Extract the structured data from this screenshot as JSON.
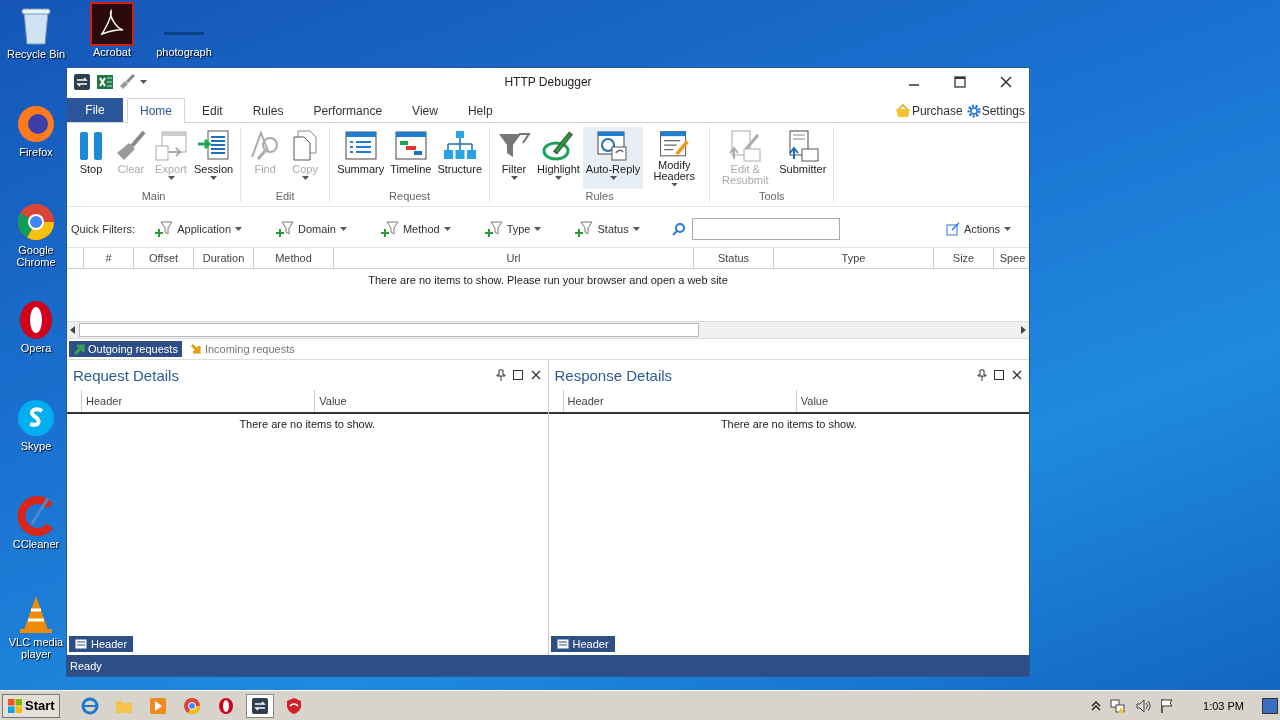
{
  "desktop": {
    "icons": [
      {
        "label": "Recycle Bin",
        "kind": "recycle"
      },
      {
        "label": "Firefox",
        "kind": "firefox"
      },
      {
        "label": "Google Chrome",
        "kind": "chrome"
      },
      {
        "label": "Opera",
        "kind": "opera"
      },
      {
        "label": "Skype",
        "kind": "skype"
      },
      {
        "label": "CCleaner",
        "kind": "ccleaner"
      },
      {
        "label": "VLC media player",
        "kind": "vlc"
      }
    ],
    "top_icons": [
      {
        "label": "Acrobat",
        "kind": "acrobat"
      },
      {
        "label": "photograph",
        "kind": "blank"
      }
    ]
  },
  "window": {
    "title": "HTTP Debugger",
    "file_tab": "File",
    "tabs": [
      {
        "label": "Home",
        "selected": true
      },
      {
        "label": "Edit",
        "selected": false
      },
      {
        "label": "Rules",
        "selected": false
      },
      {
        "label": "Performance",
        "selected": false
      },
      {
        "label": "View",
        "selected": false
      },
      {
        "label": "Help",
        "selected": false
      }
    ],
    "purchase": "Purchase",
    "settings": "Settings",
    "ribbon": [
      {
        "name": "Main",
        "buttons": [
          {
            "label": "Stop",
            "kind": "stop",
            "disabled": false,
            "dropdown": false
          },
          {
            "label": "Clear",
            "kind": "clear",
            "disabled": true,
            "dropdown": false
          },
          {
            "label": "Export",
            "kind": "export",
            "disabled": true,
            "dropdown": true
          },
          {
            "label": "Session",
            "kind": "session",
            "disabled": false,
            "dropdown": true
          }
        ]
      },
      {
        "name": "Edit",
        "buttons": [
          {
            "label": "Find",
            "kind": "find",
            "disabled": true,
            "dropdown": false
          },
          {
            "label": "Copy",
            "kind": "copy",
            "disabled": true,
            "dropdown": true
          }
        ]
      },
      {
        "name": "Request",
        "buttons": [
          {
            "label": "Summary",
            "kind": "summary",
            "disabled": false,
            "dropdown": false
          },
          {
            "label": "Timeline",
            "kind": "timeline",
            "disabled": false,
            "dropdown": false
          },
          {
            "label": "Structure",
            "kind": "structure",
            "disabled": false,
            "dropdown": false
          }
        ]
      },
      {
        "name": "Rules",
        "buttons": [
          {
            "label": "Filter",
            "kind": "filter",
            "disabled": false,
            "dropdown": true
          },
          {
            "label": "Highlight",
            "kind": "highlight",
            "disabled": false,
            "dropdown": true
          },
          {
            "label": "Auto-Reply",
            "kind": "autoreply",
            "disabled": false,
            "dropdown": true,
            "hovered": true
          },
          {
            "label": "Modify Headers",
            "kind": "modify",
            "disabled": false,
            "dropdown": true
          }
        ]
      },
      {
        "name": "Tools",
        "buttons": [
          {
            "label": "Edit & Resubmit",
            "kind": "resubmit",
            "disabled": true,
            "dropdown": false
          },
          {
            "label": "Submitter",
            "kind": "submitter",
            "disabled": false,
            "dropdown": false
          }
        ]
      }
    ],
    "quick_filters": {
      "label": "Quick Filters:",
      "filters": [
        "Application",
        "Domain",
        "Method",
        "Type",
        "Status"
      ],
      "actions": "Actions"
    },
    "columns": [
      "#",
      "Offset",
      "Duration",
      "Method",
      "Url",
      "Status",
      "Type",
      "Size",
      "Spee"
    ],
    "empty_message": "There are no items to show. Please run your browser and open a web site",
    "direction_tabs": [
      {
        "label": "Outgoing requests",
        "selected": true
      },
      {
        "label": "Incoming requests",
        "selected": false
      }
    ],
    "panels": [
      {
        "title": "Request Details",
        "columns": [
          "Header",
          "Value"
        ],
        "empty_message": "There are no items to show.",
        "footer_tab": "Header"
      },
      {
        "title": "Response Details",
        "columns": [
          "Header",
          "Value"
        ],
        "empty_message": "There are no items to show.",
        "footer_tab": "Header"
      }
    ],
    "status": "Ready"
  },
  "taskbar": {
    "start": "Start",
    "apps": [
      {
        "kind": "ie",
        "selected": false
      },
      {
        "kind": "folder",
        "selected": false
      },
      {
        "kind": "media",
        "selected": false
      },
      {
        "kind": "chrome",
        "selected": false
      },
      {
        "kind": "opera",
        "selected": false
      },
      {
        "kind": "debugger",
        "selected": true
      },
      {
        "kind": "shield",
        "selected": false
      }
    ],
    "clock": "1:03 PM"
  }
}
